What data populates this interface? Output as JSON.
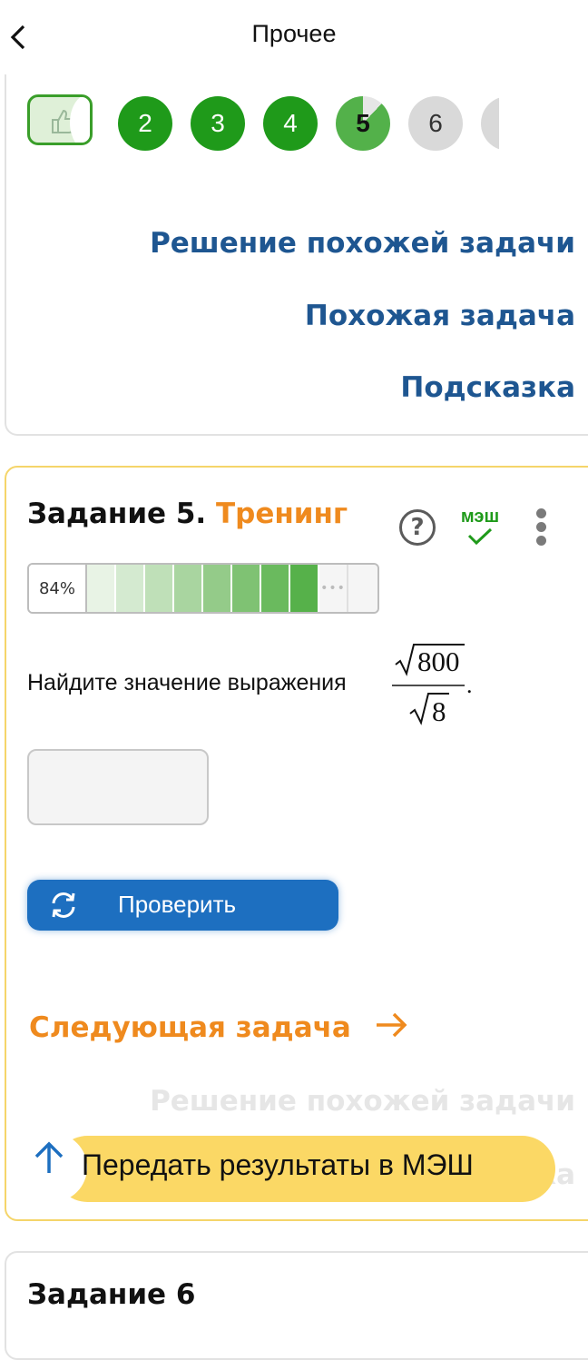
{
  "header": {
    "title": "Прочее",
    "back_icon": "chevron-left-icon"
  },
  "progress_nav": {
    "first_icon": "thumbs-up-icon",
    "items": [
      {
        "label": "2",
        "state": "done"
      },
      {
        "label": "3",
        "state": "done"
      },
      {
        "label": "4",
        "state": "done"
      },
      {
        "label": "5",
        "state": "current"
      },
      {
        "label": "6",
        "state": "todo"
      }
    ]
  },
  "prev_card": {
    "links": [
      "Решение похожей задачи",
      "Похожая задача",
      "Подсказка"
    ]
  },
  "task": {
    "title_prefix": "Задание 5.",
    "title_mode": "Тренинг",
    "help_label": "?",
    "mesh_label": "МЭШ",
    "progress_label": "84%",
    "progress_segments": 8,
    "more_label": "•••",
    "question": "Найдите значение выражения",
    "numerator": "800",
    "denominator": "8",
    "punct": ".",
    "answer_value": "",
    "check_label": "Проверить",
    "next_label": "Следующая задача",
    "faded_link": "Решение похожей задачи",
    "faded_link2": "ка",
    "send_label": "Передать результаты в МЭШ"
  },
  "next_card": {
    "title": "Задание 6"
  },
  "colors": {
    "accent_green": "#1f9a1a",
    "blue": "#1e5691",
    "orange": "#ef8a1e",
    "button_blue": "#1d6fc0",
    "yellow": "#fbd865"
  }
}
